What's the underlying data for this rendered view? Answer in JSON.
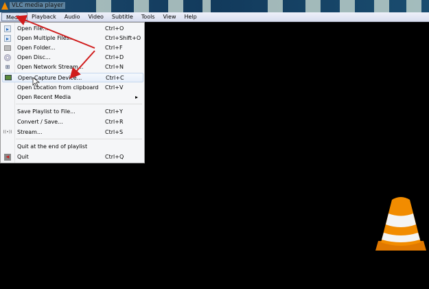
{
  "window": {
    "title": "VLC media player"
  },
  "menubar": [
    "Media",
    "Playback",
    "Audio",
    "Video",
    "Subtitle",
    "Tools",
    "View",
    "Help"
  ],
  "media_menu": {
    "items": [
      {
        "label": "Open File...",
        "shortcut": "Ctrl+O",
        "icon": "play-file-icon"
      },
      {
        "label": "Open Multiple Files...",
        "shortcut": "Ctrl+Shift+O",
        "icon": "play-file-icon"
      },
      {
        "label": "Open Folder...",
        "shortcut": "Ctrl+F",
        "icon": "folder-icon"
      },
      {
        "label": "Open Disc...",
        "shortcut": "Ctrl+D",
        "icon": "disc-icon"
      },
      {
        "label": "Open Network Stream...",
        "shortcut": "Ctrl+N",
        "icon": "network-icon"
      },
      {
        "label": "Open Capture Device...",
        "shortcut": "Ctrl+C",
        "icon": "capture-card-icon"
      },
      {
        "label": "Open Location from clipboard",
        "shortcut": "Ctrl+V",
        "icon": ""
      },
      {
        "label": "Open Recent Media",
        "shortcut": "",
        "icon": ""
      },
      {
        "label": "Save Playlist to File...",
        "shortcut": "Ctrl+Y",
        "icon": ""
      },
      {
        "label": "Convert / Save...",
        "shortcut": "Ctrl+R",
        "icon": ""
      },
      {
        "label": "Stream...",
        "shortcut": "Ctrl+S",
        "icon": "stream-icon"
      },
      {
        "label": "Quit at the end of playlist",
        "shortcut": "",
        "icon": ""
      },
      {
        "label": "Quit",
        "shortcut": "Ctrl+Q",
        "icon": "quit-icon"
      }
    ],
    "submenu_arrow": "▸"
  },
  "colors": {
    "accent": "#f08a00",
    "arrow": "#d01c1c"
  }
}
